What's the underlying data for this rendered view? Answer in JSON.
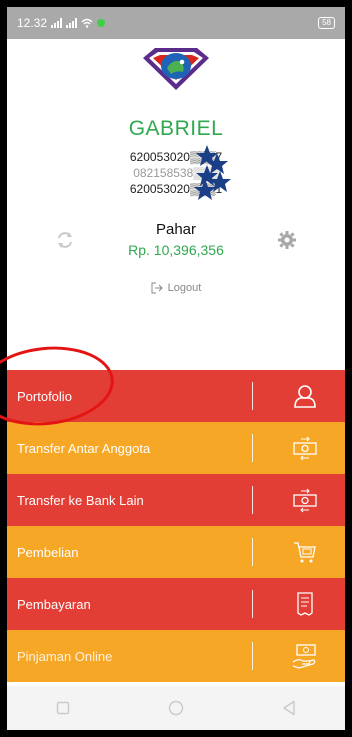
{
  "status": {
    "time": "12.32",
    "battery": "58"
  },
  "profile": {
    "name": "GABRIEL",
    "id_line_1": "620053020▒▒▒7",
    "id_line_2": "082158538▒▒▒",
    "id_line_3": "620053020▒▒▒1"
  },
  "account": {
    "name": "Pahar",
    "balance": "Rp. 10,396,356"
  },
  "logout_label": "Logout",
  "menu": [
    {
      "label": "Portofolio",
      "color": "#e33e35",
      "icon": "user-icon"
    },
    {
      "label": "Transfer Antar Anggota",
      "color": "#f6a726",
      "icon": "money-transfer-icon"
    },
    {
      "label": "Transfer ke Bank Lain",
      "color": "#e33e35",
      "icon": "money-transfer-icon"
    },
    {
      "label": "Pembelian",
      "color": "#f6a726",
      "icon": "cart-icon"
    },
    {
      "label": "Pembayaran",
      "color": "#e33e35",
      "icon": "receipt-icon"
    },
    {
      "label": "Pinjaman Online",
      "color": "#f6a726",
      "icon": "cash-hand-icon"
    }
  ]
}
